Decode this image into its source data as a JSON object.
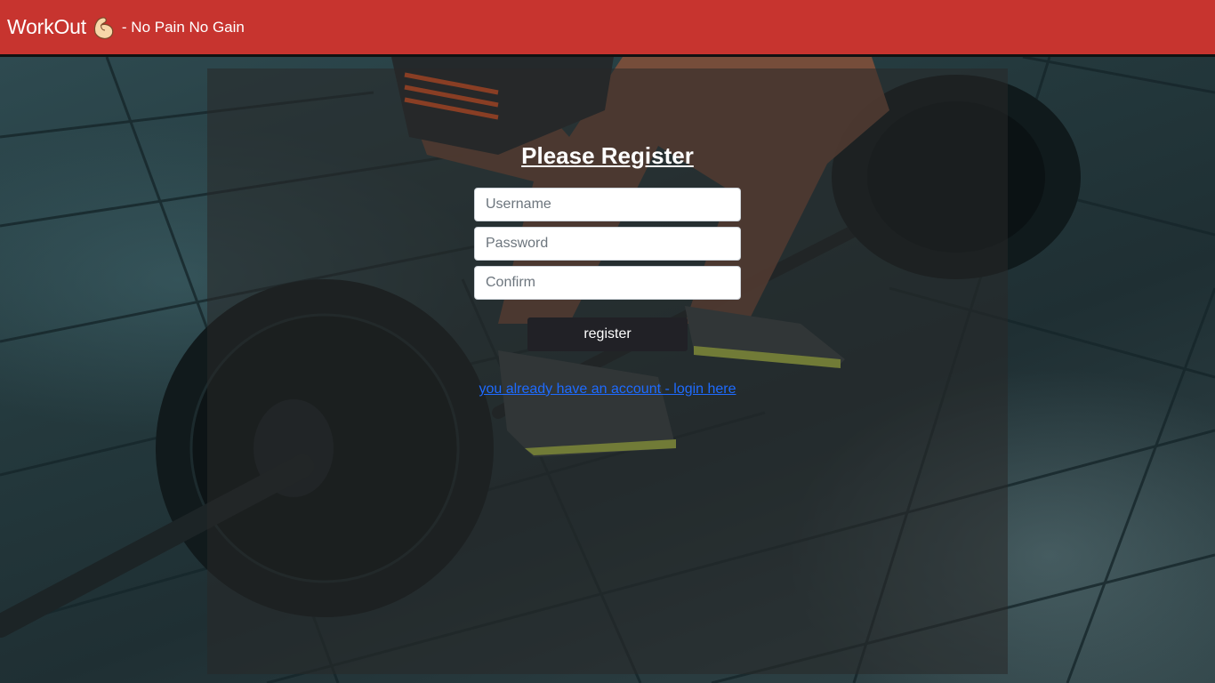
{
  "header": {
    "brand": "WorkOut",
    "brand_icon": "flexed-biceps-icon",
    "tagline": "- No Pain No Gain",
    "bg_color": "#c7342f"
  },
  "form": {
    "title": "Please Register",
    "username_placeholder": "Username",
    "password_placeholder": "Password",
    "confirm_placeholder": "Confirm",
    "username_value": "",
    "password_value": "",
    "confirm_value": "",
    "submit_label": "register",
    "login_link_label": "you already have an account - login here"
  },
  "colors": {
    "link": "#1e6bff",
    "button_bg": "#212126"
  }
}
